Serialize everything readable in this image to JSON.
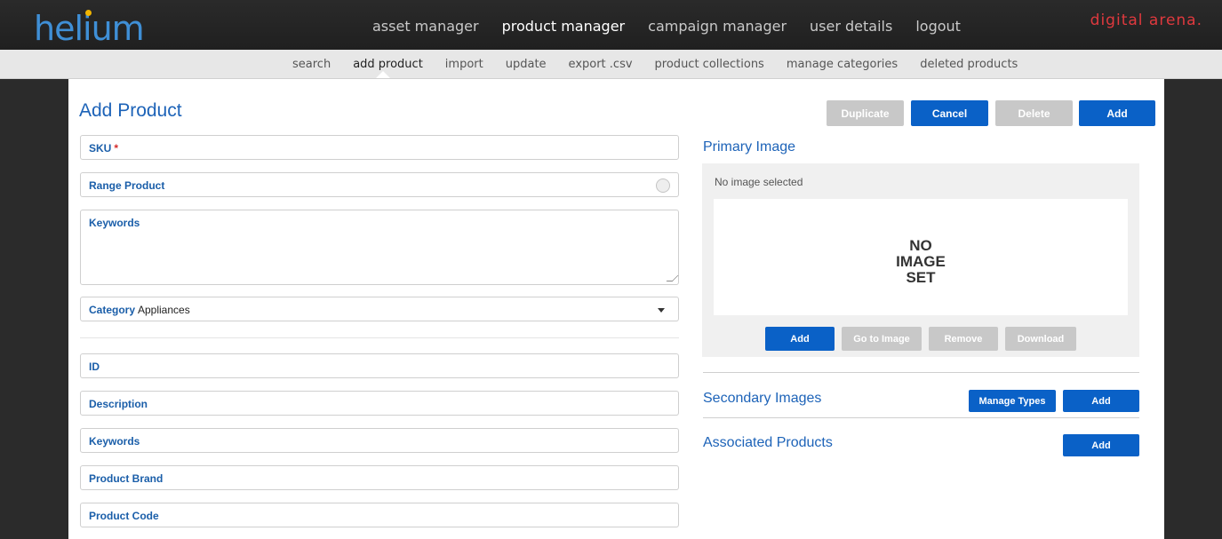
{
  "app": {
    "logo": "helium",
    "brand": "digital arena."
  },
  "main_nav": [
    "asset manager",
    "product manager",
    "campaign manager",
    "user details",
    "logout"
  ],
  "sub_nav": [
    "search",
    "add product",
    "import",
    "update",
    "export .csv",
    "product collections",
    "manage categories",
    "deleted products"
  ],
  "page": {
    "title": "Add Product"
  },
  "actions": {
    "duplicate": "Duplicate",
    "cancel": "Cancel",
    "delete": "Delete",
    "add": "Add"
  },
  "form": {
    "sku": "SKU",
    "sku_required": "*",
    "range_product": "Range Product",
    "keywords": "Keywords",
    "category_label": "Category",
    "category_value": "Appliances",
    "id": "ID",
    "description": "Description",
    "keywords2": "Keywords",
    "product_brand": "Product Brand",
    "product_code": "Product Code"
  },
  "primary_image": {
    "title": "Primary Image",
    "status": "No image selected",
    "placeholder": [
      "NO",
      "IMAGE",
      "SET"
    ],
    "buttons": {
      "add": "Add",
      "goto": "Go to Image",
      "remove": "Remove",
      "download": "Download"
    }
  },
  "secondary_images": {
    "title": "Secondary Images",
    "manage": "Manage Types",
    "add": "Add"
  },
  "associated_products": {
    "title": "Associated Products",
    "add": "Add"
  },
  "colors": {
    "accent": "#0a61c7",
    "heading": "#1d63b8",
    "brand": "#e0393e",
    "logo_dot": "#f0b400"
  }
}
